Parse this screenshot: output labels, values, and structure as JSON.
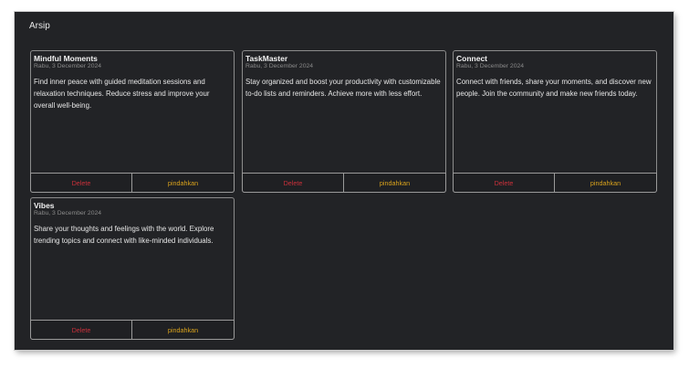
{
  "section": {
    "title": "Arsip"
  },
  "cards": [
    {
      "title": "Mindful Moments",
      "date": "Rabu, 3 December 2024",
      "description": "Find inner peace with guided meditation sessions and relaxation techniques. Reduce stress and improve your overall well-being.",
      "delete_label": "Delete",
      "move_label": "pindahkan"
    },
    {
      "title": "TaskMaster",
      "date": "Rabu, 3 December 2024",
      "description": "Stay organized and boost your productivity with customizable to-do lists and reminders. Achieve more with less effort.",
      "delete_label": "Delete",
      "move_label": "pindahkan"
    },
    {
      "title": "Connect",
      "date": "Rabu, 3 December 2024",
      "description": "Connect with friends, share your moments, and discover new people. Join the community and make new friends today.",
      "delete_label": "Delete",
      "move_label": "pindahkan"
    },
    {
      "title": "Vibes",
      "date": "Rabu, 3 December 2024",
      "description": "Share your thoughts and feelings with the world. Explore trending topics and connect with like-minded individuals.",
      "delete_label": "Delete",
      "move_label": "pindahkan"
    }
  ],
  "colors": {
    "background": "#222326",
    "delete": "#c9303a",
    "move": "#d9a21c"
  }
}
